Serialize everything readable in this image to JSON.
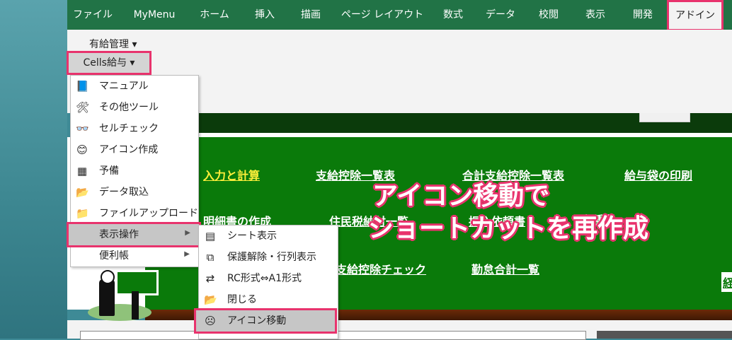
{
  "ribbon": {
    "tabs": [
      {
        "label": "ファイル",
        "active": false
      },
      {
        "label": "MyMenu",
        "active": false
      },
      {
        "label": "ホーム",
        "active": false
      },
      {
        "label": "挿入",
        "active": false
      },
      {
        "label": "描画",
        "active": false
      },
      {
        "label": "ページ レイアウト",
        "active": false
      },
      {
        "label": "数式",
        "active": false
      },
      {
        "label": "データ",
        "active": false
      },
      {
        "label": "校閲",
        "active": false
      },
      {
        "label": "表示",
        "active": false
      },
      {
        "label": "開発",
        "active": false
      },
      {
        "label": "アドイン",
        "active": true
      }
    ]
  },
  "toolbar": {
    "paid_leave_label": "有給管理 ▾",
    "cells_salary_label": "Cells給与 ▾"
  },
  "menu": {
    "items": [
      {
        "label": "マニュアル",
        "icon": "manual-icon",
        "glyph": "📘"
      },
      {
        "label": "その他ツール",
        "icon": "tools-icon",
        "glyph": "🛠"
      },
      {
        "label": "セルチェック",
        "icon": "glasses-icon",
        "glyph": "👓"
      },
      {
        "label": "アイコン作成",
        "icon": "smiley-icon",
        "glyph": "😊"
      },
      {
        "label": "予備",
        "icon": "grid-icon",
        "glyph": "▦"
      },
      {
        "label": "データ取込",
        "icon": "folder-import-icon",
        "glyph": "📂"
      },
      {
        "label": "ファイルアップロード",
        "icon": "folder-upload-icon",
        "glyph": "📁"
      },
      {
        "label": "表示操作",
        "icon": "",
        "glyph": ""
      },
      {
        "label": "便利帳",
        "icon": "",
        "glyph": ""
      }
    ],
    "submenu_arrow": "▶"
  },
  "submenu": {
    "items": [
      {
        "label": "シート表示",
        "icon": "sheet-icon",
        "glyph": "▤"
      },
      {
        "label": "保護解除・行列表示",
        "icon": "unprotect-icon",
        "glyph": "⧉"
      },
      {
        "label": "RC形式⇔A1形式",
        "icon": "format-switch-icon",
        "glyph": "⇄"
      },
      {
        "label": "閉じる",
        "icon": "close-folder-icon",
        "glyph": "📂"
      },
      {
        "label": "アイコン移動",
        "icon": "sad-face-icon",
        "glyph": "☹"
      }
    ]
  },
  "board": {
    "links": [
      "入力と計算",
      "支給控除一覧表",
      "合計支給控除一覧表",
      "給与袋の印刷",
      "明細書の作成",
      "住民税納付一覧",
      "振込依頼書",
      "金種表",
      "支給控除チェック",
      "勤怠合計一覧",
      "経"
    ]
  },
  "caption": {
    "line1": "アイコン移動で",
    "line2": "ショートカットを再作成"
  }
}
